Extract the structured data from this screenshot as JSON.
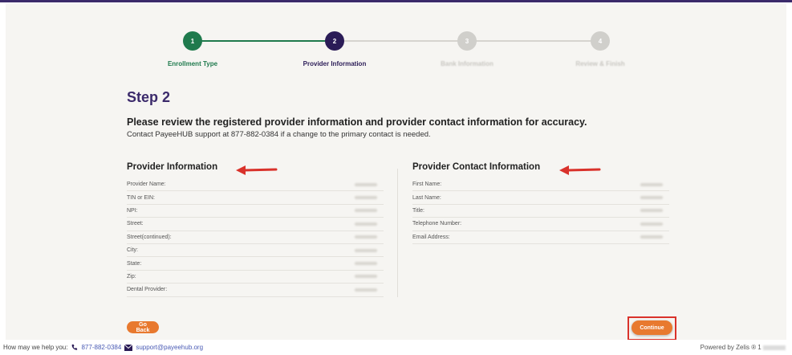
{
  "stepper": {
    "steps": [
      {
        "number": "1",
        "label": "Enrollment Type",
        "state": "complete",
        "color": "#1f7a4d"
      },
      {
        "number": "2",
        "label": "Provider Information",
        "state": "current",
        "color": "#2b1c57"
      },
      {
        "number": "3",
        "label": "Bank Information",
        "state": "upcoming",
        "color": "#cfcfcf"
      },
      {
        "number": "4",
        "label": "Review & Finish",
        "state": "upcoming",
        "color": "#cfcfcf"
      }
    ]
  },
  "page": {
    "title": "Step 2",
    "instructions": "Please review the registered provider information and provider contact information for accuracy.",
    "support_note": "Contact PayeeHUB support at 877-882-0384 if a change to the primary contact is needed."
  },
  "provider_info": {
    "title": "Provider Information",
    "rows": [
      "Provider Name:",
      "TIN or EIN:",
      "NPI:",
      "Street:",
      "Street(continued):",
      "City:",
      "State:",
      "Zip:",
      "Dental Provider:"
    ]
  },
  "contact_info": {
    "title": "Provider Contact Information",
    "rows": [
      "First Name:",
      "Last Name:",
      "Title:",
      "Telephone Number:",
      "Email Address:"
    ]
  },
  "buttons": {
    "go_back": "Go Back",
    "continue": "Continue"
  },
  "footer": {
    "help_text": "How may we help you:",
    "phone": "877-882-0384",
    "email": "support@payeehub.org",
    "powered_by": "Powered by Zelis ® 1"
  },
  "colors": {
    "accent_purple": "#3b2a6b",
    "button_orange": "#e8792f",
    "annotation_red": "#d9322b"
  }
}
